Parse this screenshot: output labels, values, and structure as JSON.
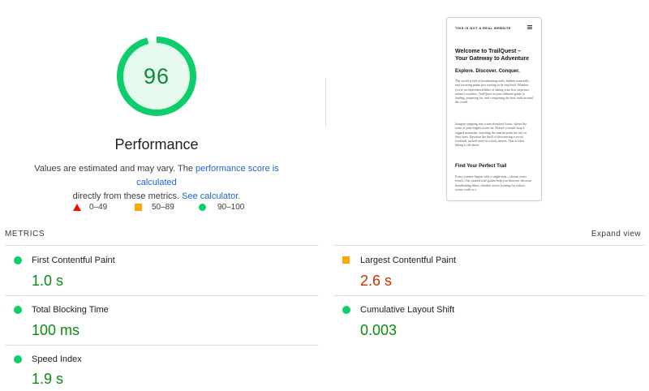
{
  "score": {
    "value": "96",
    "fraction": 0.96,
    "title": "Performance",
    "color_ring": "#0cce6b",
    "color_fill": "#e6f9ee",
    "color_text": "#0b8a3a"
  },
  "description": {
    "pre": "Values are estimated and may vary. The ",
    "link1": "performance score is calculated",
    "mid": "directly from these metrics. ",
    "link2": "See calculator."
  },
  "legend": [
    {
      "range": "0–49",
      "shape": "triangle",
      "color": "#eb0f00"
    },
    {
      "range": "50–89",
      "shape": "square",
      "color": "#ffa400"
    },
    {
      "range": "90–100",
      "shape": "circle",
      "color": "#0cce6b"
    }
  ],
  "screenshot": {
    "site_label": "THIS IS NOT A REAL WEBSITE",
    "heading": "Welcome to TrailQuest – Your Gateway to Adventure",
    "subheading": "Explore. Discover. Conquer.",
    "para1": "The world is full of breathtaking trails, hidden waterfalls, and towering peaks just waiting to be explored. Whether you're an experienced hiker or taking your first steps into nature's wonders, TrailQuest is your ultimate guide to finding, preparing for, and conquering the best trails around the world.",
    "para2": "Imagine stepping into a sun-drenched forest, where the scent of pine lingers in the air. Picture yourself atop a rugged mountain, watching the sunrise paint the sky in fiery hues. Envision the thrill of discovering a secret waterfall, tucked away in a lush canyon. This is what hiking is all about.",
    "section_title": "Find Your Perfect Trail",
    "para3": "Every journey begins with a single step—choose yours wisely. Our curated trail guides help you discover the most breathtaking hikes, whether you're looking for a short scenic walk or a"
  },
  "metrics": {
    "label": "METRICS",
    "expand": "Expand view",
    "items": [
      {
        "name": "First Contentful Paint",
        "value": "1.0 s",
        "status": "good"
      },
      {
        "name": "Largest Contentful Paint",
        "value": "2.6 s",
        "status": "average"
      },
      {
        "name": "Total Blocking Time",
        "value": "100 ms",
        "status": "good"
      },
      {
        "name": "Cumulative Layout Shift",
        "value": "0.003",
        "status": "good"
      },
      {
        "name": "Speed Index",
        "value": "1.9 s",
        "status": "good"
      }
    ]
  }
}
